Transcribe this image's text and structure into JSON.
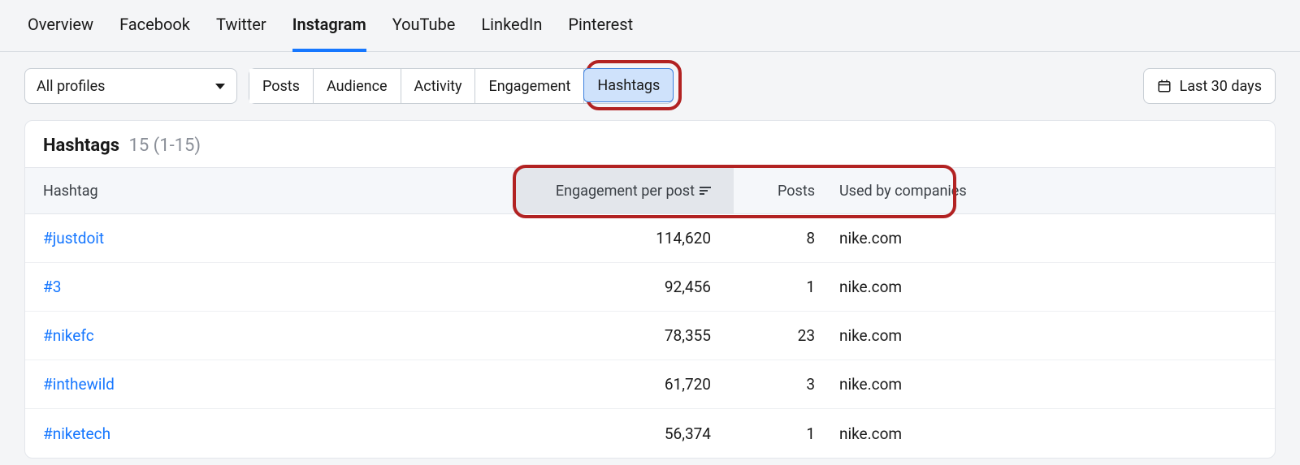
{
  "nav": {
    "tabs": [
      {
        "label": "Overview"
      },
      {
        "label": "Facebook"
      },
      {
        "label": "Twitter"
      },
      {
        "label": "Instagram",
        "active": true
      },
      {
        "label": "YouTube"
      },
      {
        "label": "LinkedIn"
      },
      {
        "label": "Pinterest"
      }
    ]
  },
  "filters": {
    "profile_select_label": "All profiles",
    "segments": [
      {
        "label": "Posts"
      },
      {
        "label": "Audience"
      },
      {
        "label": "Activity"
      },
      {
        "label": "Engagement"
      },
      {
        "label": "Hashtags",
        "active": true
      }
    ],
    "date_label": "Last 30 days"
  },
  "card": {
    "title": "Hashtags",
    "count_text": "15 (1-15)"
  },
  "table": {
    "columns": {
      "hashtag": "Hashtag",
      "engagement": "Engagement per post",
      "posts": "Posts",
      "company": "Used by companies"
    },
    "rows": [
      {
        "tag": "#justdoit",
        "engagement": "114,620",
        "posts": "8",
        "company": "nike.com"
      },
      {
        "tag": "#3",
        "engagement": "92,456",
        "posts": "1",
        "company": "nike.com"
      },
      {
        "tag": "#nikefc",
        "engagement": "78,355",
        "posts": "23",
        "company": "nike.com"
      },
      {
        "tag": "#inthewild",
        "engagement": "61,720",
        "posts": "3",
        "company": "nike.com"
      },
      {
        "tag": "#niketech",
        "engagement": "56,374",
        "posts": "1",
        "company": "nike.com"
      }
    ]
  }
}
